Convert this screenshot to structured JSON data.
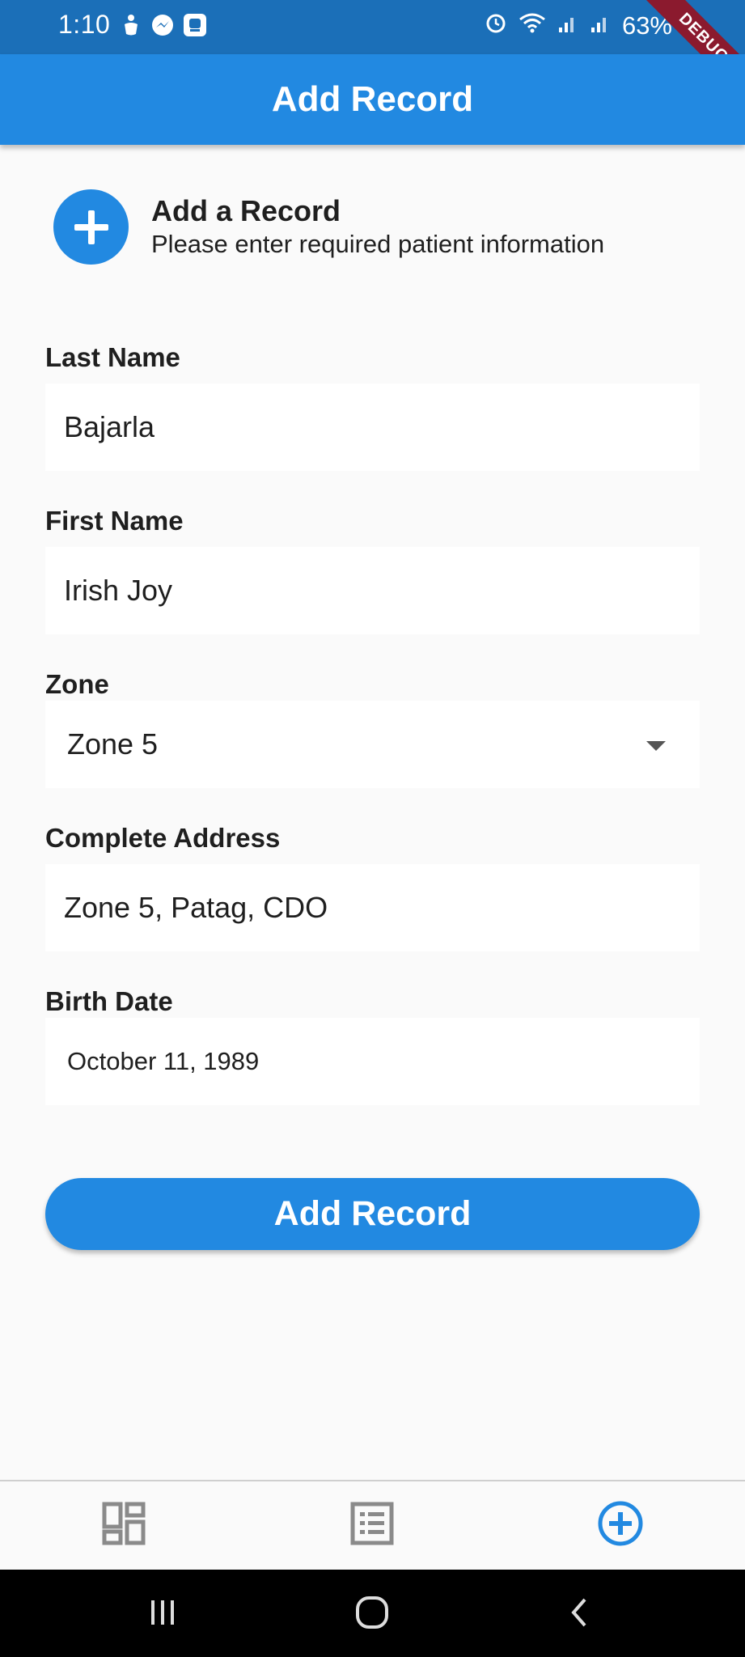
{
  "status_bar": {
    "time": "1:10",
    "battery": "63%",
    "debug_label": "DEBUG"
  },
  "app_bar": {
    "title": "Add Record"
  },
  "header": {
    "title": "Add a Record",
    "subtitle": "Please enter required patient information"
  },
  "form": {
    "last_name": {
      "label": "Last Name",
      "value": "Bajarla"
    },
    "first_name": {
      "label": "First Name",
      "value": "Irish Joy"
    },
    "zone": {
      "label": "Zone",
      "value": "Zone 5"
    },
    "address": {
      "label": "Complete Address",
      "value": "Zone 5, Patag, CDO"
    },
    "birth_date": {
      "label": "Birth Date",
      "value": "October 11, 1989"
    }
  },
  "submit_label": "Add Record",
  "bottom_nav": [
    {
      "icon": "dashboard-icon",
      "active": false
    },
    {
      "icon": "list-icon",
      "active": false
    },
    {
      "icon": "add-circle-icon",
      "active": true
    }
  ],
  "colors": {
    "primary": "#2289e1",
    "status_bar": "#1b6fb8",
    "inactive_icon": "#8a8a8a"
  }
}
